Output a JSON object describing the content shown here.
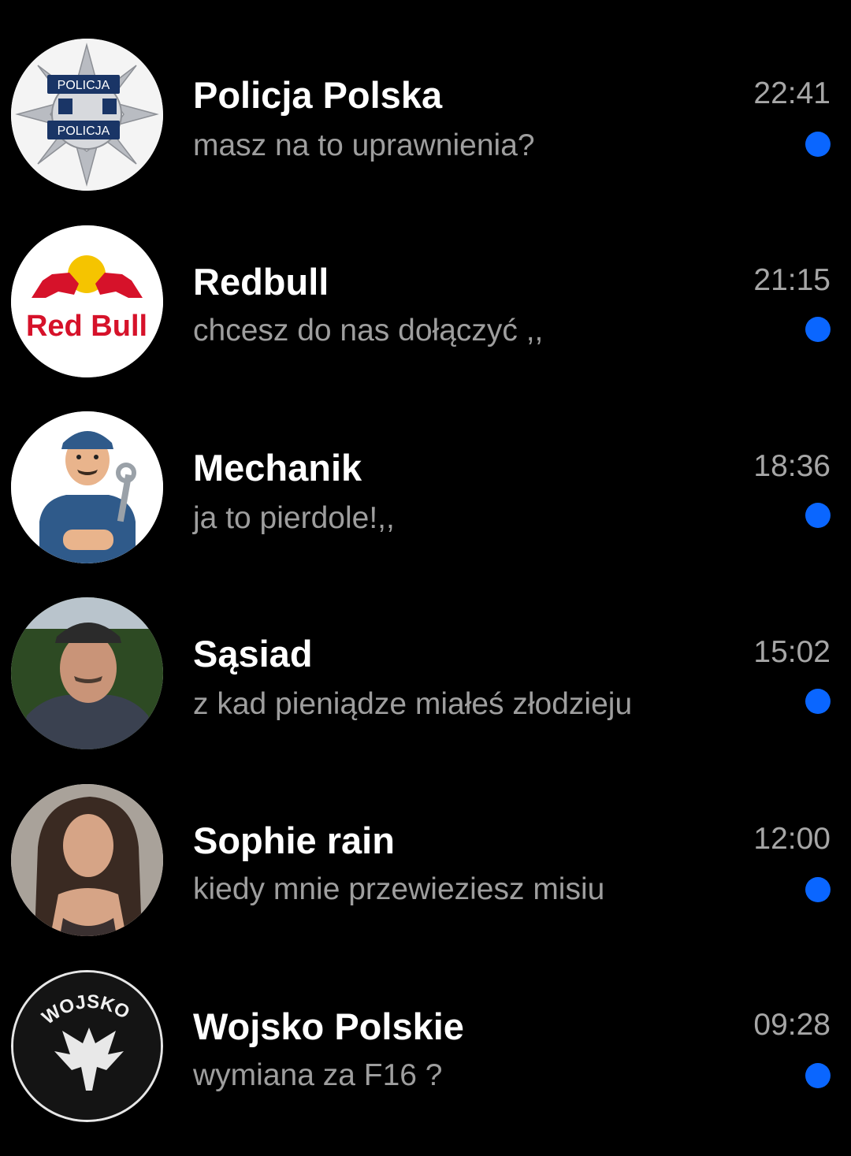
{
  "chats": [
    {
      "name": "Policja Polska",
      "preview": "masz na to uprawnienia?",
      "time": "22:41",
      "unread": true,
      "avatar": "police-badge-avatar",
      "avatar_text": "POLICJA"
    },
    {
      "name": "Redbull",
      "preview": "chcesz do nas dołączyć ,,",
      "time": "21:15",
      "unread": true,
      "avatar": "redbull-logo-avatar",
      "avatar_text": "Red Bull"
    },
    {
      "name": "Mechanik",
      "preview": "ja to pierdole!,,",
      "time": "18:36",
      "unread": true,
      "avatar": "mechanic-cartoon-avatar"
    },
    {
      "name": "Sąsiad",
      "preview": "z kad pieniądze miałeś złodzieju",
      "time": "15:02",
      "unread": true,
      "avatar": "neighbor-photo-avatar"
    },
    {
      "name": "Sophie rain",
      "preview": "kiedy mnie przewieziesz misiu",
      "time": "12:00",
      "unread": true,
      "avatar": "woman-photo-avatar"
    },
    {
      "name": "Wojsko Polskie",
      "preview": "wymiana za F16 ?",
      "time": "09:28",
      "unread": true,
      "avatar": "army-eagle-avatar",
      "avatar_text": "WOJSKO"
    }
  ],
  "colors": {
    "background": "#000000",
    "unread_dot": "#0a66ff",
    "preview": "#9e9e9e"
  }
}
